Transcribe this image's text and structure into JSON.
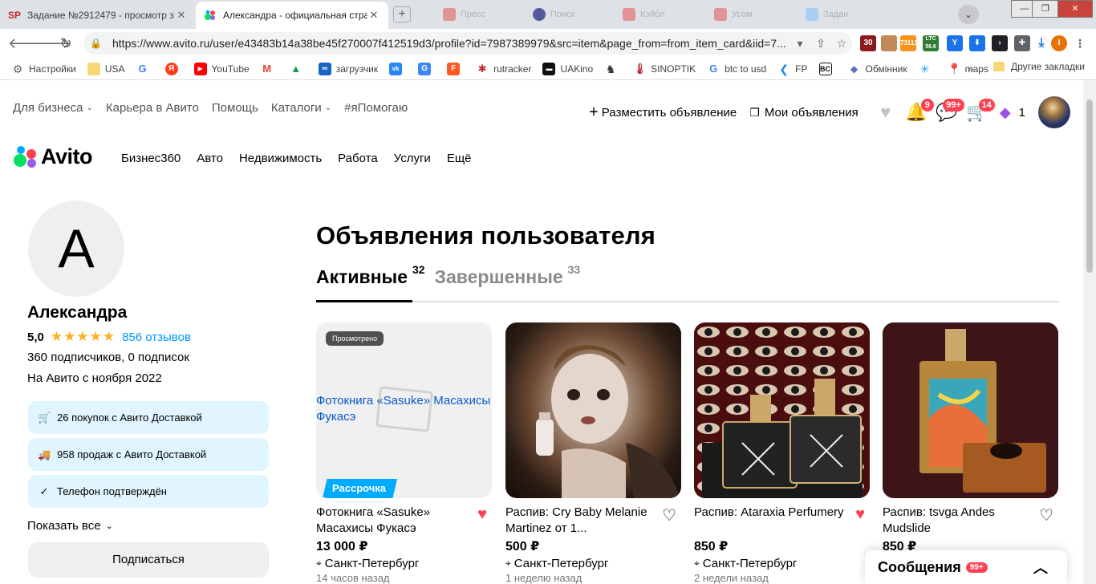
{
  "browser": {
    "tabs": [
      {
        "favicon": "SP",
        "title": "Задание №2912479 - просмотр з"
      },
      {
        "favicon": "avito-icon",
        "title": "Александра - официальная стран"
      }
    ],
    "ghost_tabs": [
      "Пресс",
      "Поиск",
      "Кэйбл",
      "Усом",
      "Задан"
    ],
    "url": "https://www.avito.ru/user/e43483b14a38be45f270007f412519d3/profile?id=7987389979&src=item&page_from=from_item_card&iid=7...",
    "extensions": [
      {
        "label": "30",
        "color": "#8b1a1a"
      },
      {
        "label": "",
        "color": "#c28a56"
      },
      {
        "label": "73113",
        "color": "#f7931a"
      },
      {
        "label": "LTC 56.6",
        "color": "#2f7d32"
      },
      {
        "label": "",
        "color": "#1a73e8"
      },
      {
        "label": "",
        "color": "#1a73e8"
      },
      {
        "label": "",
        "color": "#202124"
      },
      {
        "label": "",
        "color": "#5f6368"
      },
      {
        "label": "",
        "color": "#1a73e8"
      },
      {
        "label": "I",
        "color": "#e8710a"
      }
    ],
    "bookmarks": [
      {
        "label": "Настройки",
        "color": "#5f6368"
      },
      {
        "label": "USA",
        "color": "#f7d774"
      },
      {
        "label": "",
        "color": "#4285f4",
        "glyph": "G"
      },
      {
        "label": "",
        "color": "#fc3f1d",
        "glyph": "Я"
      },
      {
        "label": "YouTube",
        "color": "#ff0000"
      },
      {
        "label": "",
        "color": "#ea4335",
        "glyph": "M"
      },
      {
        "label": "",
        "color": "#0f9d58"
      },
      {
        "label": "загрузчик",
        "color": "#1565c0"
      },
      {
        "label": "",
        "color": "#2787f5",
        "glyph": "vk"
      },
      {
        "label": "",
        "color": "#4285f4",
        "glyph": "G"
      },
      {
        "label": "",
        "color": "#ff5722",
        "glyph": "F"
      },
      {
        "label": "rutracker",
        "color": "#c62828"
      },
      {
        "label": "UAKino",
        "color": "#111"
      },
      {
        "label": "",
        "color": "#333"
      },
      {
        "label": "SINOPTIK",
        "color": "#c62828"
      },
      {
        "label": "btc to usd",
        "color": "#4285f4",
        "glyph": "G"
      },
      {
        "label": "FP",
        "color": "#1e88e5"
      },
      {
        "label": "",
        "color": "#111",
        "glyph": "BC"
      },
      {
        "label": "Обмінник",
        "color": "#5c6bc0"
      },
      {
        "label": "",
        "color": "#03a9f4"
      },
      {
        "label": "maps",
        "color": "#34a853"
      }
    ],
    "more_label": "»",
    "other_bookmarks": "Другие закладки"
  },
  "header": {
    "top_nav": [
      {
        "label": "Для бизнеса",
        "has_chevron": true
      },
      {
        "label": "Карьера в Авито",
        "has_chevron": false
      },
      {
        "label": "Помощь",
        "has_chevron": false
      },
      {
        "label": "Каталоги",
        "has_chevron": true
      },
      {
        "label": "#яПомогаю",
        "has_chevron": false
      }
    ],
    "post_ad": "Разместить объявление",
    "my_ads": "Мои объявления",
    "notifications_badge": "9",
    "messages_badge": "99+",
    "cart_badge": "14",
    "wallet_count": "1",
    "logo_text": "Avito",
    "categories": [
      "Бизнес360",
      "Авто",
      "Недвижимость",
      "Работа",
      "Услуги",
      "Ещё"
    ]
  },
  "profile": {
    "avatar_letter": "А",
    "name": "Александра",
    "rating": "5,0",
    "stars": "★★★★★",
    "reviews": "856 отзывов",
    "subscribers": "360 подписчиков, 0 подписок",
    "since": "На Авито с ноября 2022",
    "badges": [
      {
        "icon": "cart-icon",
        "text": "26 покупок с Авито Доставкой"
      },
      {
        "icon": "truck-icon",
        "text": "958 продаж с Авито Доставкой"
      },
      {
        "icon": "check-circle-icon",
        "text": "Телефон подтверждён"
      }
    ],
    "show_all": "Показать все",
    "subscribe": "Подписаться"
  },
  "main": {
    "title": "Объявления пользователя",
    "tabs": [
      {
        "label": "Активные",
        "count": "32"
      },
      {
        "label": "Завершенные",
        "count": "33"
      }
    ],
    "items": [
      {
        "title": "Фотокнига «Sasuke» Масахисы Фукасэ",
        "alt": "Фотокнига «Sasuke» Масахисы Фукасэ",
        "price": "13 000 ₽",
        "city": "Санкт-Петербург",
        "time": "14 часов назад",
        "seen": "Просмотрено",
        "installment": "Рассрочка",
        "favorite": true
      },
      {
        "title": "Распив: Cry Baby Melanie Martinez от 1...",
        "price": "500 ₽",
        "city": "Санкт-Петербург",
        "time": "1 неделю назад",
        "favorite": false
      },
      {
        "title": "Распив: Ataraxia Perfumery",
        "price": "850 ₽",
        "city": "Санкт-Петербург",
        "time": "2 недели назад",
        "favorite": true
      },
      {
        "title": "Распив: tsvga Andes Mudslide",
        "price": "850 ₽",
        "city": "",
        "time": "",
        "favorite": false
      }
    ]
  },
  "messages_panel": {
    "label": "Сообщения",
    "badge": "99+"
  },
  "colors": {
    "accent": "#00aaff",
    "heart_active": "#ff4053",
    "link": "#0099f7",
    "badge_bg": "#e0f5fe"
  }
}
